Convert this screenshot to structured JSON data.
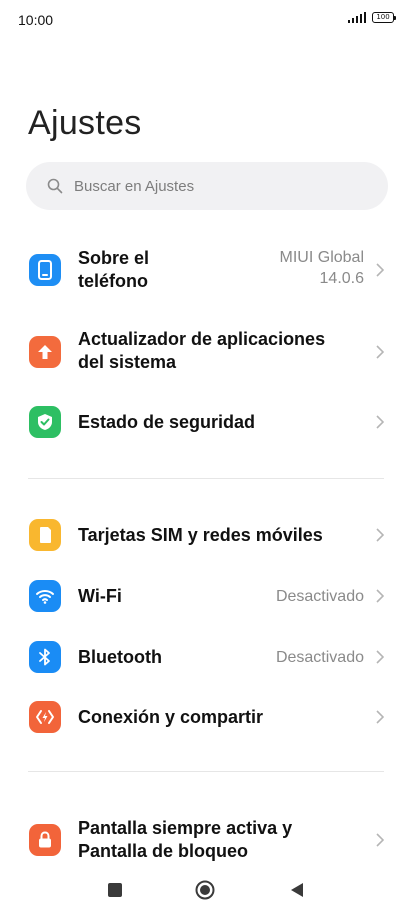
{
  "status_bar": {
    "time": "10:00",
    "battery": "100"
  },
  "page": {
    "title": "Ajustes"
  },
  "search": {
    "placeholder": "Buscar en Ajustes"
  },
  "colors": {
    "about_phone": "#1e8ef4",
    "updater": "#f36b3d",
    "security": "#2dbf63",
    "sim": "#f9b72f",
    "wifi": "#1a8cf5",
    "bluetooth": "#1a8cf5",
    "connection": "#f2643a",
    "lock_screen": "#f2643a"
  },
  "settings": {
    "about_phone": {
      "label_line1": "Sobre el",
      "label_line2": "teléfono",
      "value_line1": "MIUI Global",
      "value_line2": "14.0.6",
      "icon": "phone-icon"
    },
    "updater": {
      "label_line1": "Actualizador de aplicaciones",
      "label_line2": "del sistema",
      "icon": "arrow-up-icon"
    },
    "security": {
      "label": "Estado de seguridad",
      "icon": "shield-check-icon"
    },
    "sim": {
      "label": "Tarjetas SIM y redes móviles",
      "icon": "sim-card-icon"
    },
    "wifi": {
      "label": "Wi-Fi",
      "value": "Desactivado",
      "icon": "wifi-icon"
    },
    "bluetooth": {
      "label": "Bluetooth",
      "value": "Desactivado",
      "icon": "bluetooth-icon"
    },
    "connection": {
      "label": "Conexión y compartir",
      "icon": "share-connection-icon"
    },
    "lock_screen": {
      "label_line1": "Pantalla siempre activa y",
      "label_line2": "Pantalla de bloqueo",
      "icon": "lock-icon"
    }
  },
  "nav": {
    "recent": "square-icon",
    "home": "circle-icon",
    "back": "triangle-back-icon"
  }
}
